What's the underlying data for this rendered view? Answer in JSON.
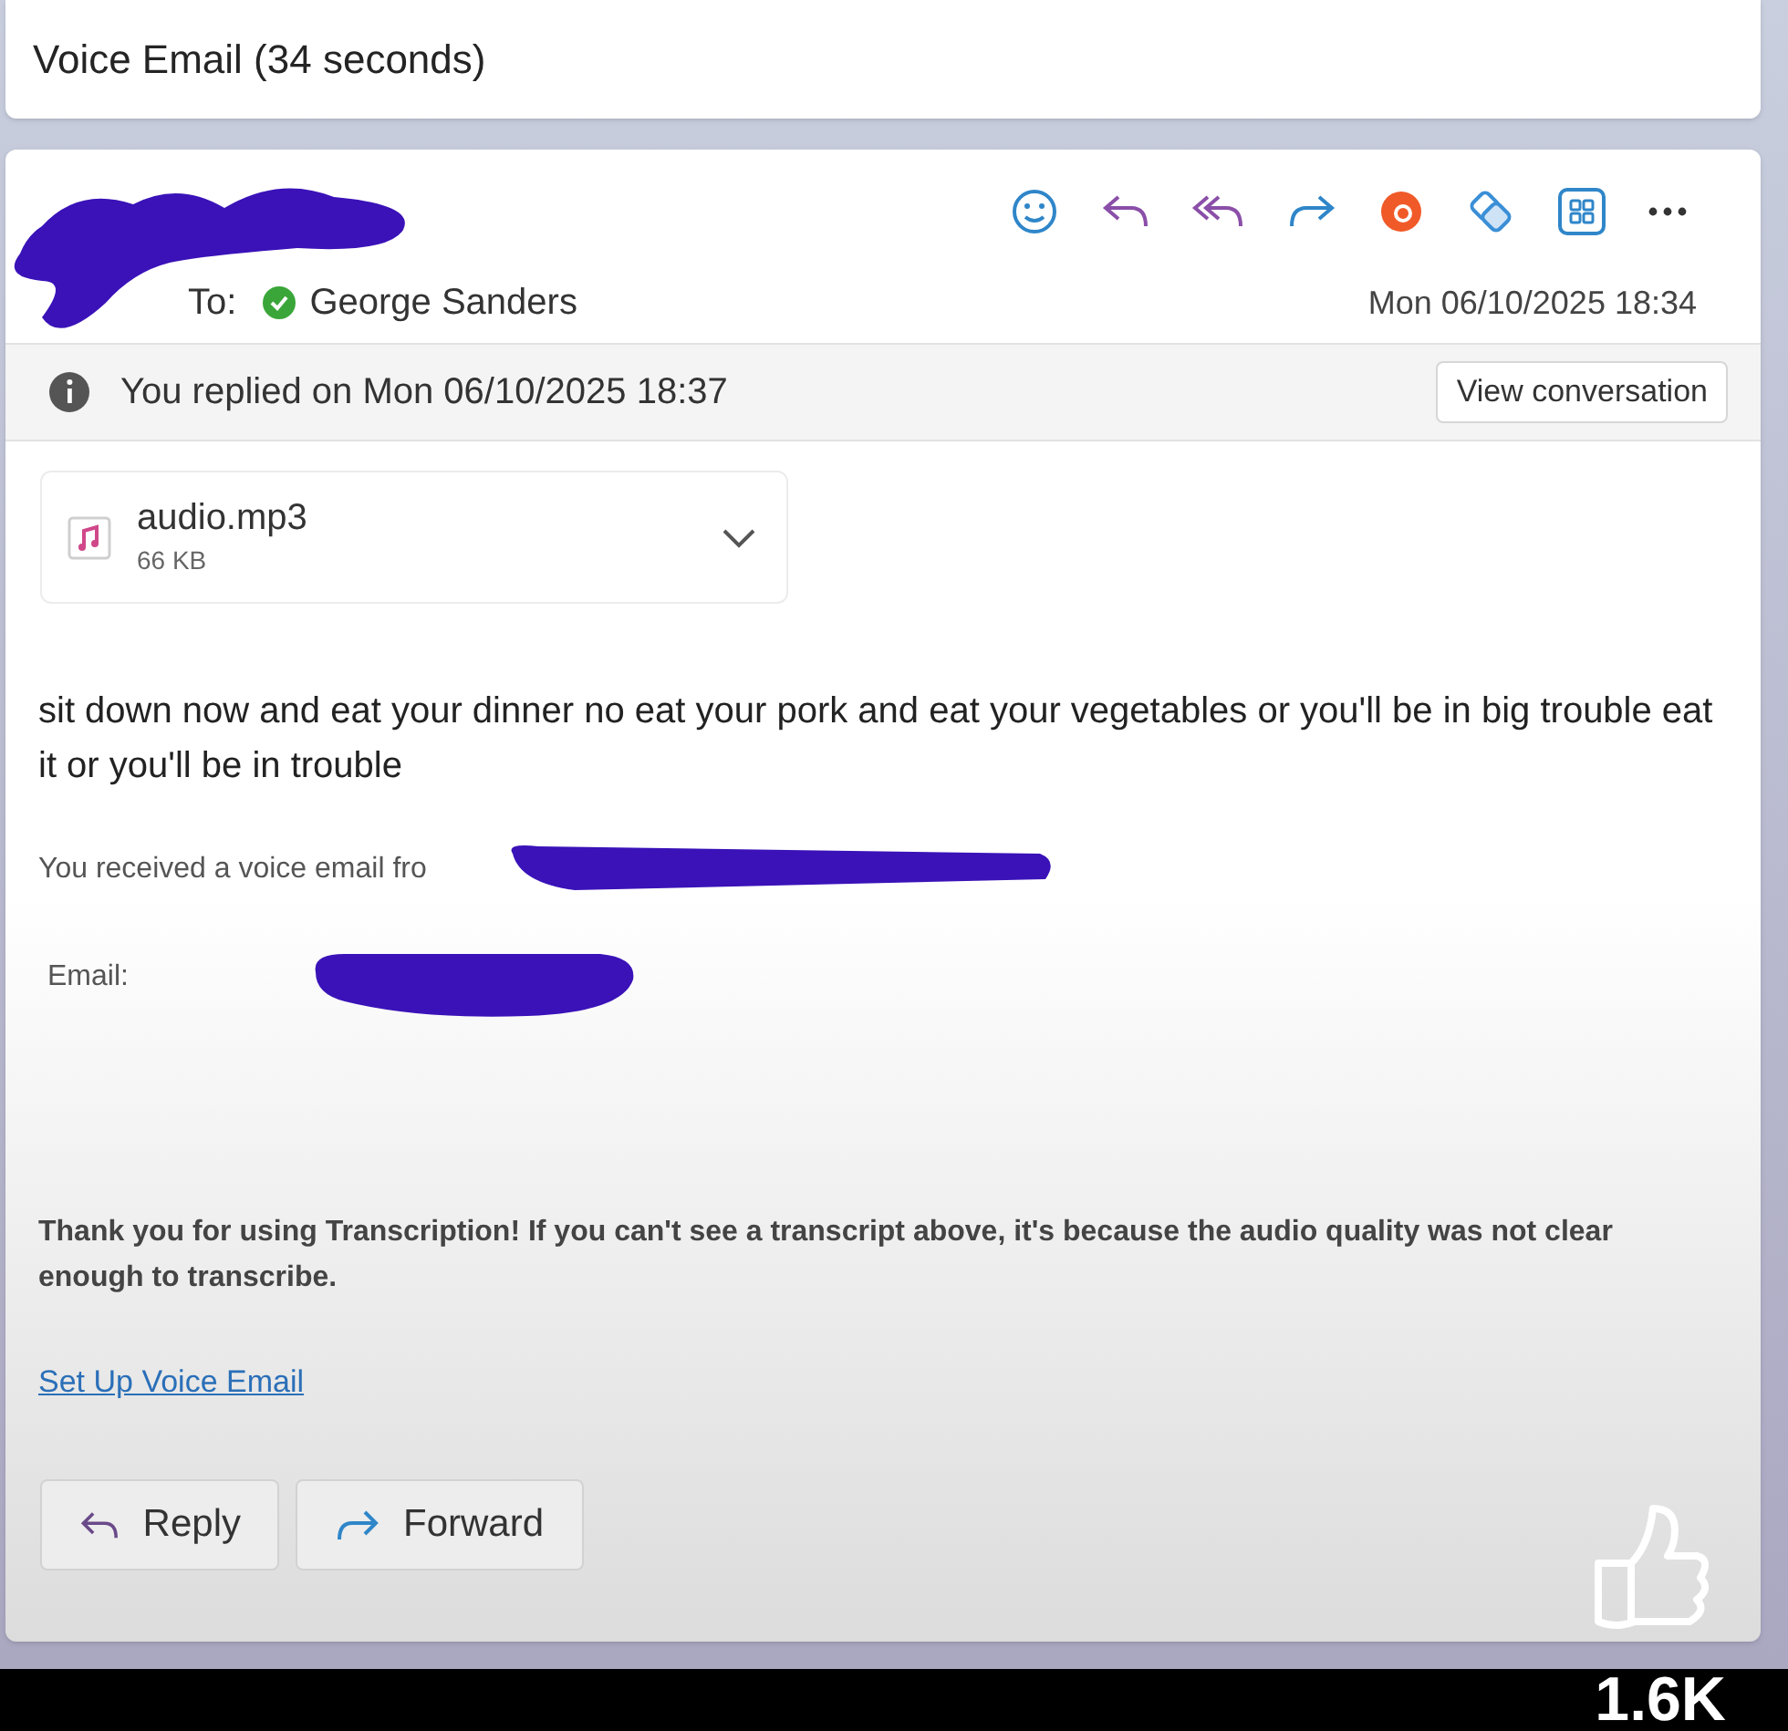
{
  "subject": "Voice Email (34 seconds)",
  "header": {
    "to_label": "To:",
    "recipient": "George Sanders",
    "date": "Mon 06/10/2025 18:34"
  },
  "reply_notice": {
    "text": "You replied on Mon 06/10/2025 18:37",
    "button": "View conversation"
  },
  "attachment": {
    "name": "audio.mp3",
    "size": "66 KB"
  },
  "body": {
    "transcript": "sit down now and eat your dinner no eat your pork and eat your vegetables or you'll be in big trouble eat it or you'll be in trouble",
    "received": "You received a voice email fro",
    "email_label": "Email:",
    "thanks": "Thank you for using Transcription! If you can't see a transcript above, it's because the audio quality was not clear enough to transcribe.",
    "link": "Set Up Voice Email"
  },
  "actions": [
    "Reply",
    "Forward"
  ],
  "overlay": {
    "likes": "1.6K"
  }
}
